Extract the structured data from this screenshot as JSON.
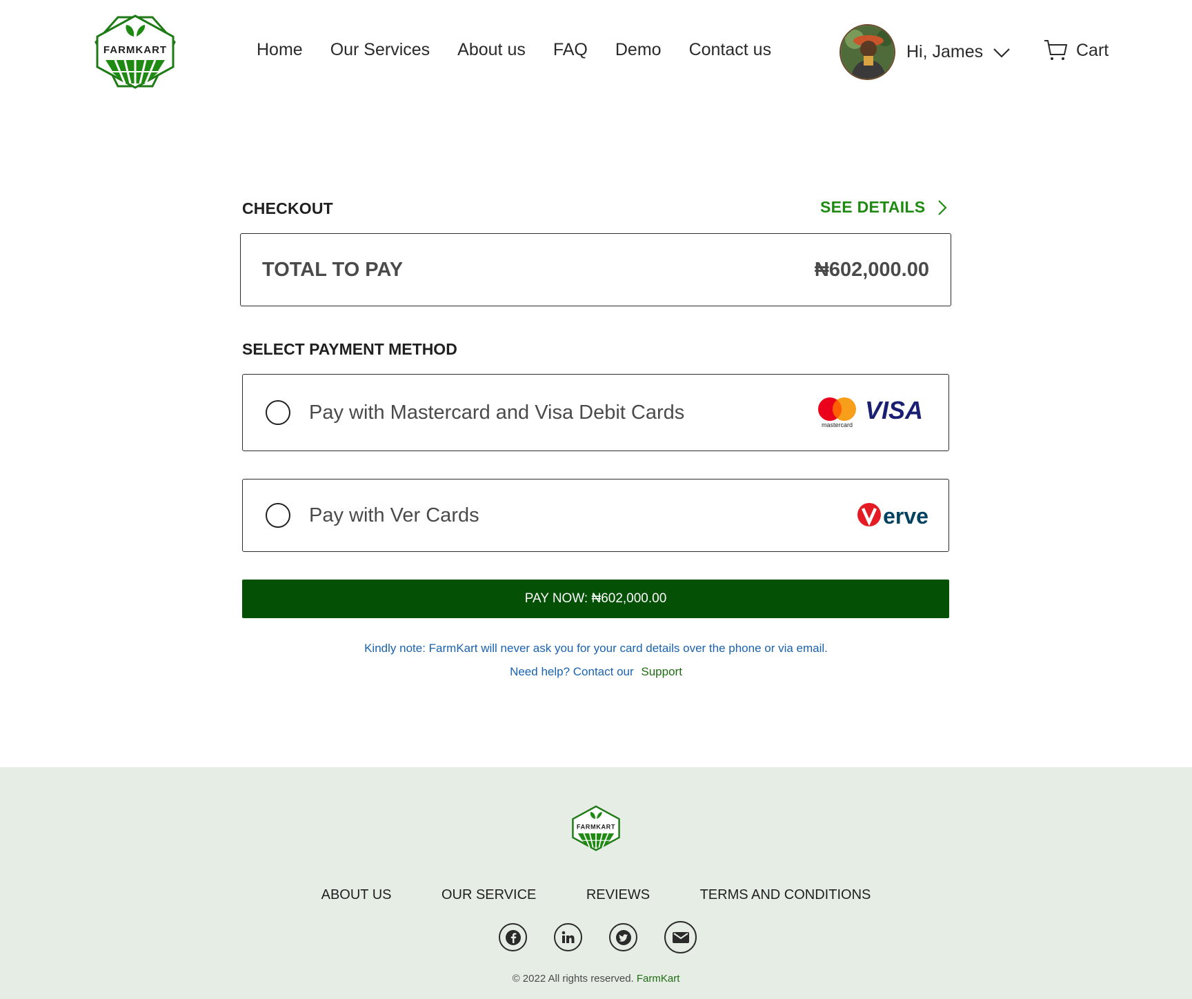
{
  "brand": {
    "name": "FARMKART",
    "brand_color": "#1e8a12",
    "dark_green": "#045106"
  },
  "nav": {
    "items": [
      "Home",
      "Our Services",
      "About us",
      "FAQ",
      "Demo",
      "Contact us"
    ]
  },
  "user": {
    "greeting": "Hi, James"
  },
  "cart": {
    "label": "Cart"
  },
  "checkout": {
    "title": "CHECKOUT",
    "see_details": "SEE DETAILS",
    "total_label": "TOTAL TO PAY",
    "total_amount": "₦602,000.00"
  },
  "payment": {
    "title": "SELECT PAYMENT METHOD",
    "options": [
      {
        "label": "Pay with Mastercard and Visa Debit Cards",
        "logos": [
          "mastercard",
          "VISA"
        ]
      },
      {
        "label": "Pay with Ver Cards",
        "logos": [
          "Verve"
        ]
      }
    ],
    "pay_button": "PAY NOW: ₦602,000.00",
    "note": "Kindly note: FarmKart will never ask you for your card details over the phone or via email.",
    "help_text": "Need help? Contact our",
    "help_link": "Support"
  },
  "footer": {
    "logo_text": "FARMKART",
    "nav": [
      "ABOUT US",
      "OUR SERVICE",
      "REVIEWS",
      "TERMS AND CONDITIONS"
    ],
    "socials": [
      "facebook-icon",
      "linkedin-icon",
      "twitter-icon",
      "mail-icon"
    ],
    "copyright": "© 2022 All rights reserved.",
    "copyright_brand": "FarmKart"
  }
}
